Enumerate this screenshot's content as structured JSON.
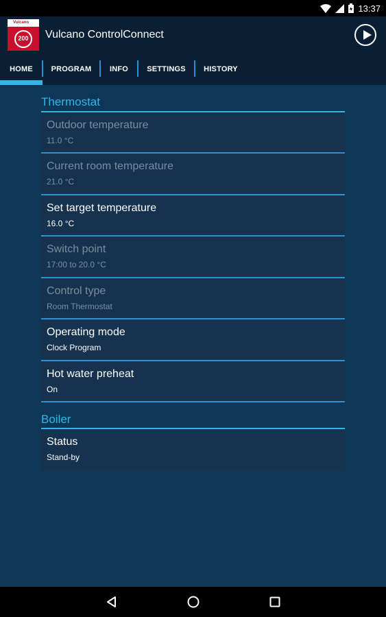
{
  "status_bar": {
    "time": "13:37",
    "icons": [
      "wifi-icon",
      "signal-icon",
      "battery-icon"
    ]
  },
  "app_bar": {
    "logo_brand": "Vulcano",
    "logo_badge": "200",
    "title": "Vulcano ControlConnect",
    "play_icon": "play-icon"
  },
  "tabs": [
    {
      "label": "HOME",
      "selected": true
    },
    {
      "label": "PROGRAM",
      "selected": false
    },
    {
      "label": "INFO",
      "selected": false
    },
    {
      "label": "SETTINGS",
      "selected": false
    },
    {
      "label": "HISTORY",
      "selected": false
    }
  ],
  "sections": {
    "thermostat": {
      "header": "Thermostat",
      "rows": [
        {
          "title": "Outdoor temperature",
          "value": "11.0 °C",
          "enabled": false
        },
        {
          "title": "Current room temperature",
          "value": "21.0 °C",
          "enabled": false
        },
        {
          "title": "Set target temperature",
          "value": "16.0 °C",
          "enabled": true
        },
        {
          "title": "Switch point",
          "value": "17:00 to 20.0 °C",
          "enabled": false
        },
        {
          "title": "Control type",
          "value": "Room Thermostat",
          "enabled": false
        },
        {
          "title": "Operating mode",
          "value": "Clock Program",
          "enabled": true
        },
        {
          "title": "Hot water preheat",
          "value": "On",
          "enabled": true
        }
      ]
    },
    "boiler": {
      "header": "Boiler",
      "rows": [
        {
          "title": "Status",
          "value": "Stand-by",
          "enabled": true
        }
      ]
    }
  },
  "nav_bar": {
    "icons": [
      "back-icon",
      "home-icon",
      "recents-icon"
    ]
  },
  "colors": {
    "background": "#0f3758",
    "bar": "#0a1f33",
    "accent": "#33b5e5",
    "row": "#16324f",
    "disabled_text": "#7b8d9f"
  }
}
